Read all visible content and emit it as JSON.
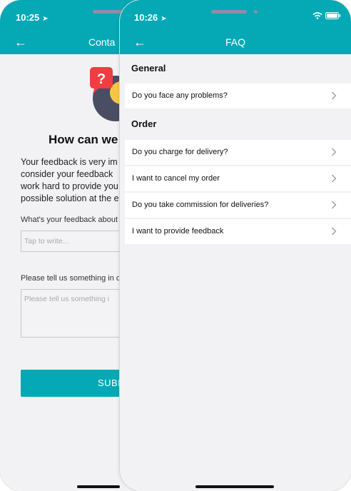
{
  "back_phone": {
    "status_time": "10:25",
    "nav_title": "Conta",
    "heading": "How can we",
    "paragraph_lines": [
      "Your feedback is very im",
      "consider your feedback",
      "work hard to provide you",
      "possible solution at the e"
    ],
    "feedback_label": "What's your feedback about",
    "feedback_placeholder": "Tap to write...",
    "detail_label": "Please tell us something in d",
    "detail_placeholder": "Please tell us something i",
    "submit_label": "SUBM"
  },
  "front_phone": {
    "status_time": "10:26",
    "nav_title": "FAQ",
    "sections": [
      {
        "title": "General",
        "items": [
          "Do you face any problems?"
        ]
      },
      {
        "title": "Order",
        "items": [
          "Do you charge for delivery?",
          "I want to cancel my order",
          "Do you take commission for deliveries?",
          "I want to provide feedback"
        ]
      }
    ]
  },
  "colors": {
    "accent": "#04a9b5",
    "background": "#f2f2f4"
  },
  "icons": [
    "location-arrow-icon",
    "wifi-icon",
    "battery-icon",
    "back-arrow-icon",
    "chevron-right-icon",
    "question-bubble-icon"
  ]
}
